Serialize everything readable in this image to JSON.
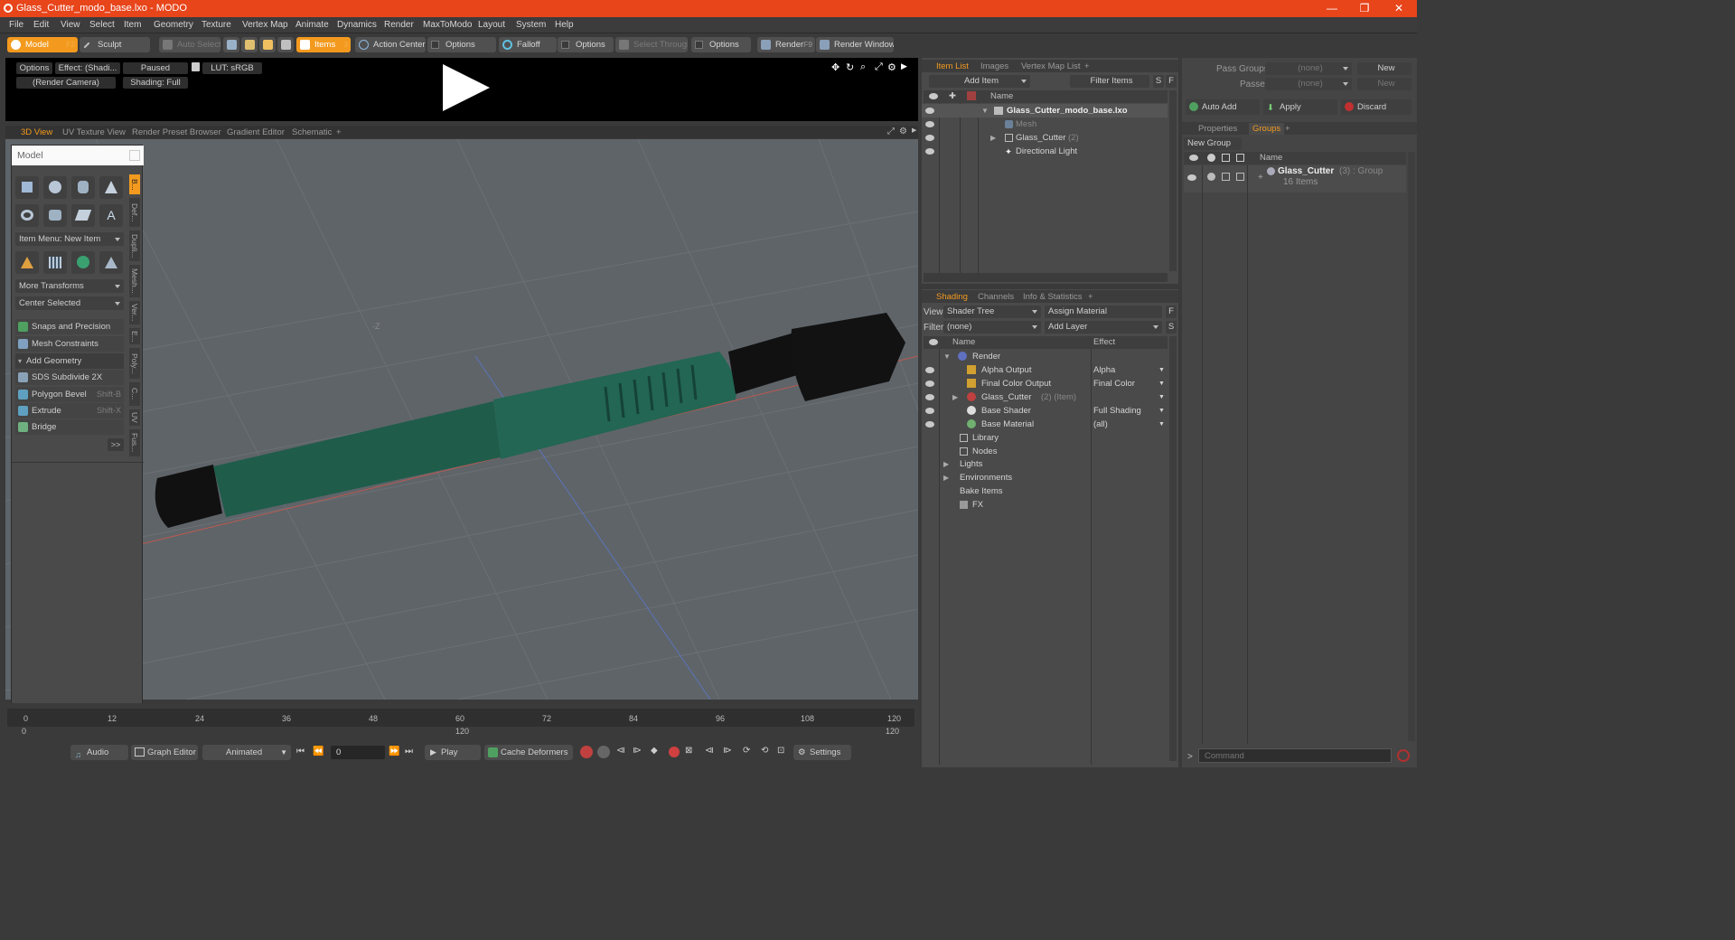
{
  "window": {
    "title": "Glass_Cutter_modo_base.lxo - MODO",
    "minimize": "—",
    "maximize": "❐",
    "close": "✕"
  },
  "menu": [
    "File",
    "Edit",
    "View",
    "Select",
    "Item",
    "Geometry",
    "Texture",
    "Vertex Map",
    "Animate",
    "Dynamics",
    "Render",
    "MaxToModo",
    "Layout",
    "System",
    "Help"
  ],
  "toolbar": {
    "model": "Model",
    "model_key": "F2",
    "sculpt": "Sculpt",
    "auto_select": "Auto Select",
    "items": "Items",
    "items_key": "3",
    "action_center": "Action Center",
    "options1": "Options",
    "falloff": "Falloff",
    "options2": "Options",
    "select_through": "Select Through",
    "options3": "Options",
    "render": "Render",
    "render_key": "F9",
    "render_window": "Render Window"
  },
  "preview": {
    "options": "Options",
    "effect": "Effect: (Shadi...",
    "paused": "Paused",
    "lut": "LUT: sRGB",
    "camera": "(Render Camera)",
    "shading": "Shading: Full"
  },
  "view_tabs": [
    "3D View",
    "UV Texture View",
    "Render Preset Browser",
    "Gradient Editor",
    "Schematic",
    "+"
  ],
  "left_panel": {
    "title": "Model",
    "item_menu": "Item Menu: New Item",
    "more_transforms": "More Transforms",
    "center_selected": "Center Selected",
    "snaps": "Snaps and Precision",
    "mesh_constraints": "Mesh Constraints",
    "add_geometry": "Add Geometry",
    "sds": "SDS Subdivide 2X",
    "polygon_bevel": "Polygon Bevel",
    "polygon_bevel_key": "Shift-B",
    "extrude": "Extrude",
    "extrude_key": "Shift-X",
    "bridge": "Bridge",
    "more": ">>",
    "vtabs": [
      "B...",
      "Def...",
      "Dupli...",
      "Mesh...",
      "Ver...",
      "E...",
      "Poly...",
      "C...",
      "UV",
      "Fus..."
    ]
  },
  "viewport": {
    "axis_label": "-Z"
  },
  "timeline": {
    "ticks": [
      "0",
      "12",
      "24",
      "36",
      "48",
      "60",
      "72",
      "84",
      "96",
      "108",
      "120"
    ],
    "start": "0",
    "mid": "120",
    "end": "120"
  },
  "bottom": {
    "audio": "Audio",
    "graph_editor": "Graph Editor",
    "animated": "Animated",
    "frame": "0",
    "play": "Play",
    "cache_deformers": "Cache Deformers",
    "settings": "Settings"
  },
  "item_list": {
    "tabs": [
      "Item List",
      "Images",
      "Vertex Map List",
      "+"
    ],
    "add_item": "Add Item",
    "filter_items": "Filter Items",
    "s": "S",
    "f": "F",
    "col_name": "Name",
    "items": [
      {
        "label": "Glass_Cutter_modo_base.lxo",
        "count": ""
      },
      {
        "label": "Mesh",
        "count": ""
      },
      {
        "label": "Glass_Cutter",
        "count": "(2)"
      },
      {
        "label": "Directional Light",
        "count": ""
      }
    ]
  },
  "shading": {
    "tabs": [
      "Shading",
      "Channels",
      "Info & Statistics",
      "+"
    ],
    "view_label": "View",
    "view_value": "Shader Tree",
    "assign_material": "Assign Material",
    "f": "F",
    "filter_label": "Filter",
    "filter_value": "(none)",
    "add_layer": "Add Layer",
    "s": "S",
    "col_name": "Name",
    "col_effect": "Effect",
    "rows": [
      {
        "label": "Render",
        "extra": "",
        "effect": ""
      },
      {
        "label": "Alpha Output",
        "extra": "",
        "effect": "Alpha"
      },
      {
        "label": "Final Color Output",
        "extra": "",
        "effect": "Final Color"
      },
      {
        "label": "Glass_Cutter",
        "extra": "(2) (Item)",
        "effect": ""
      },
      {
        "label": "Base Shader",
        "extra": "",
        "effect": "Full Shading"
      },
      {
        "label": "Base Material",
        "extra": "",
        "effect": "(all)"
      },
      {
        "label": "Library",
        "extra": "",
        "effect": ""
      },
      {
        "label": "Nodes",
        "extra": "",
        "effect": ""
      },
      {
        "label": "Lights",
        "extra": "",
        "effect": ""
      },
      {
        "label": "Environments",
        "extra": "",
        "effect": ""
      },
      {
        "label": "Bake Items",
        "extra": "",
        "effect": ""
      },
      {
        "label": "FX",
        "extra": "",
        "effect": ""
      }
    ]
  },
  "right_panel": {
    "pass_groups_label": "Pass Groups",
    "pass_groups_value": "(none)",
    "new1": "New",
    "passes_label": "Passes",
    "passes_value": "(none)",
    "new2": "New",
    "auto_add": "Auto Add",
    "apply": "Apply",
    "discard": "Discard",
    "tabs": [
      "Properties",
      "Groups",
      "+"
    ],
    "new_group": "New Group",
    "col_name": "Name",
    "group_name": "Glass_Cutter",
    "group_meta": "(3) : Group",
    "group_items": "16 Items",
    "command_placeholder": "Command"
  },
  "colors": {
    "accent": "#f39a1e",
    "title": "#e8451b",
    "model_green": "#1f5c4a"
  }
}
